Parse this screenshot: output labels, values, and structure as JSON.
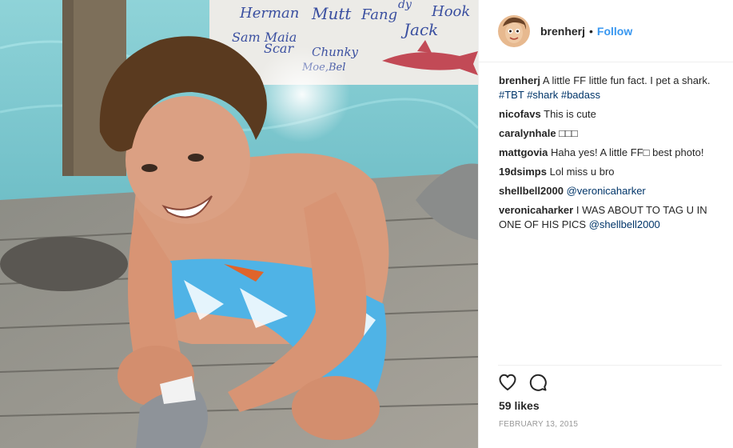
{
  "post": {
    "username": "brenherj",
    "separator": "•",
    "follow_label": "Follow",
    "likes": "59 likes",
    "date": "FEBRUARY 13, 2015"
  },
  "sign_text": {
    "line1": "Herman",
    "line2": "Mutt",
    "line3": "Fang",
    "line4": "Hook",
    "line5": "Sam Maia",
    "line6": "Jack",
    "line7": "Scar",
    "line8": "Chunky",
    "line9": "Moe,Bel",
    "line10": "dy"
  },
  "caption": {
    "user": "brenherj",
    "text": "A little FF little fun fact. I pet a shark. ",
    "tags": [
      "#TBT",
      "#shark",
      "#badass"
    ]
  },
  "comments": [
    {
      "user": "nicofavs",
      "text": "This is cute"
    },
    {
      "user": "caralynhale",
      "text": "□□□"
    },
    {
      "user": "mattgovia",
      "text": "Haha yes! A little FF□ best photo!"
    },
    {
      "user": "19dsimps",
      "text": "Lol miss u bro"
    },
    {
      "user": "shellbell2000",
      "mention": "@veronicaharker"
    },
    {
      "user": "veronicaharker",
      "text": "I WAS ABOUT TO TAG U IN ONE OF HIS PICS ",
      "mention": "@shellbell2000"
    }
  ],
  "icons": {
    "like": "heart-icon",
    "comment": "comment-bubble-icon"
  },
  "colors": {
    "link": "#3897f0",
    "hashtag": "#003569",
    "muted": "#999999"
  }
}
